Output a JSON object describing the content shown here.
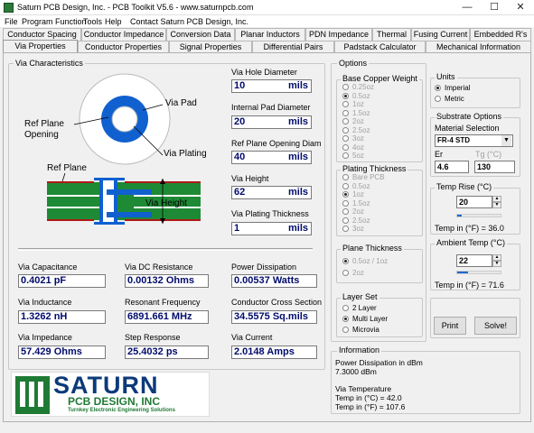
{
  "window": {
    "title": "Saturn PCB Design, Inc. - PCB Toolkit V5.6 - www.saturnpcb.com",
    "minimize_glyph": "—",
    "maximize_glyph": "☐",
    "close_glyph": "✕"
  },
  "menu": [
    "File",
    "Program Function",
    "Tools",
    "Help",
    "Contact Saturn PCB Design, Inc."
  ],
  "tabs_row1": [
    "Conductor Spacing",
    "Conductor Impedance",
    "Conversion Data",
    "Planar Inductors",
    "PDN Impedance",
    "Thermal",
    "Fusing Current",
    "Embedded R's"
  ],
  "tabs_row2": [
    "Via Properties",
    "Conductor Properties",
    "Signal Properties",
    "Differential Pairs",
    "Padstack Calculator",
    "Mechanical Information"
  ],
  "via_characteristics": {
    "title": "Via Characteristics",
    "diagram": {
      "via_pad": "Via Pad",
      "ref_plane_opening": "Ref Plane\nOpening",
      "via_plating": "Via Plating",
      "ref_plane": "Ref Plane",
      "via_height": "Via Height"
    },
    "inputs": [
      {
        "label": "Via Hole Diameter",
        "value": "10",
        "unit": "mils"
      },
      {
        "label": "Internal Pad Diameter",
        "value": "20",
        "unit": "mils"
      },
      {
        "label": "Ref Plane Opening Diam",
        "value": "40",
        "unit": "mils"
      },
      {
        "label": "Via Height",
        "value": "62",
        "unit": "mils"
      },
      {
        "label": "Via Plating Thickness",
        "value": "1",
        "unit": "mils"
      }
    ],
    "results": [
      {
        "label": "Via Capacitance",
        "value": "0.4021 pF"
      },
      {
        "label": "Via DC Resistance",
        "value": "0.00132 Ohms"
      },
      {
        "label": "Power Dissipation",
        "value": "0.00537 Watts"
      },
      {
        "label": "Via Inductance",
        "value": "1.3262 nH"
      },
      {
        "label": "Resonant Frequency",
        "value": "6891.661 MHz"
      },
      {
        "label": "Conductor Cross Section",
        "value": "34.5575 Sq.mils"
      },
      {
        "label": "Via Impedance",
        "value": "57.429 Ohms"
      },
      {
        "label": "Step Response",
        "value": "25.4032 ps"
      },
      {
        "label": "Via Current",
        "value": "2.0148 Amps"
      }
    ]
  },
  "logo": {
    "line1": "SATURN",
    "line2": "PCB DESIGN, INC",
    "line3": "Turnkey Electronic Engineering Solutions"
  },
  "options": {
    "title": "Options",
    "base_copper": {
      "title": "Base Copper Weight",
      "items": [
        "0.25oz",
        "0.5oz",
        "1oz",
        "1.5oz",
        "2oz",
        "2.5oz",
        "3oz",
        "4oz",
        "5oz"
      ],
      "selected": 1
    },
    "plating": {
      "title": "Plating Thickness",
      "items": [
        "Bare PCB",
        "0.5oz",
        "1oz",
        "1.5oz",
        "2oz",
        "2.5oz",
        "3oz"
      ],
      "selected": 2
    },
    "plane": {
      "title": "Plane Thickness",
      "items": [
        "0.5oz / 1oz",
        "2oz"
      ],
      "selected": 0
    },
    "layer_set": {
      "title": "Layer Set",
      "items": [
        "2 Layer",
        "Multi Layer",
        "Microvia"
      ],
      "selected": 1
    }
  },
  "units": {
    "title": "Units",
    "items": [
      "Imperial",
      "Metric"
    ],
    "selected": 0
  },
  "substrate": {
    "title": "Substrate Options",
    "material_label": "Material Selection",
    "material_value": "FR-4 STD",
    "er_label": "Er",
    "er_value": "4.6",
    "tg_label": "Tg (°C)",
    "tg_value": "130"
  },
  "temp_rise": {
    "title": "Temp Rise (°C)",
    "value": "20",
    "readout": "Temp in (°F) = 36.0",
    "slider_level": 0.1
  },
  "ambient": {
    "title": "Ambient Temp (°C)",
    "value": "22",
    "readout": "Temp in (°F) = 71.6",
    "slider_level": 0.25
  },
  "buttons": {
    "print": "Print",
    "solve": "Solve!"
  },
  "information": {
    "title": "Information",
    "lines": [
      "Power Dissipation in dBm",
      "7.3000 dBm",
      "",
      "Via Temperature",
      "Temp in (°C) = 42.0",
      "Temp in (°F) = 107.6"
    ]
  },
  "colors": {
    "field_text": "#000b6b",
    "pcb_green": "#1e8a35",
    "pad_blue": "#1060d0",
    "plane_red": "#b01818"
  }
}
